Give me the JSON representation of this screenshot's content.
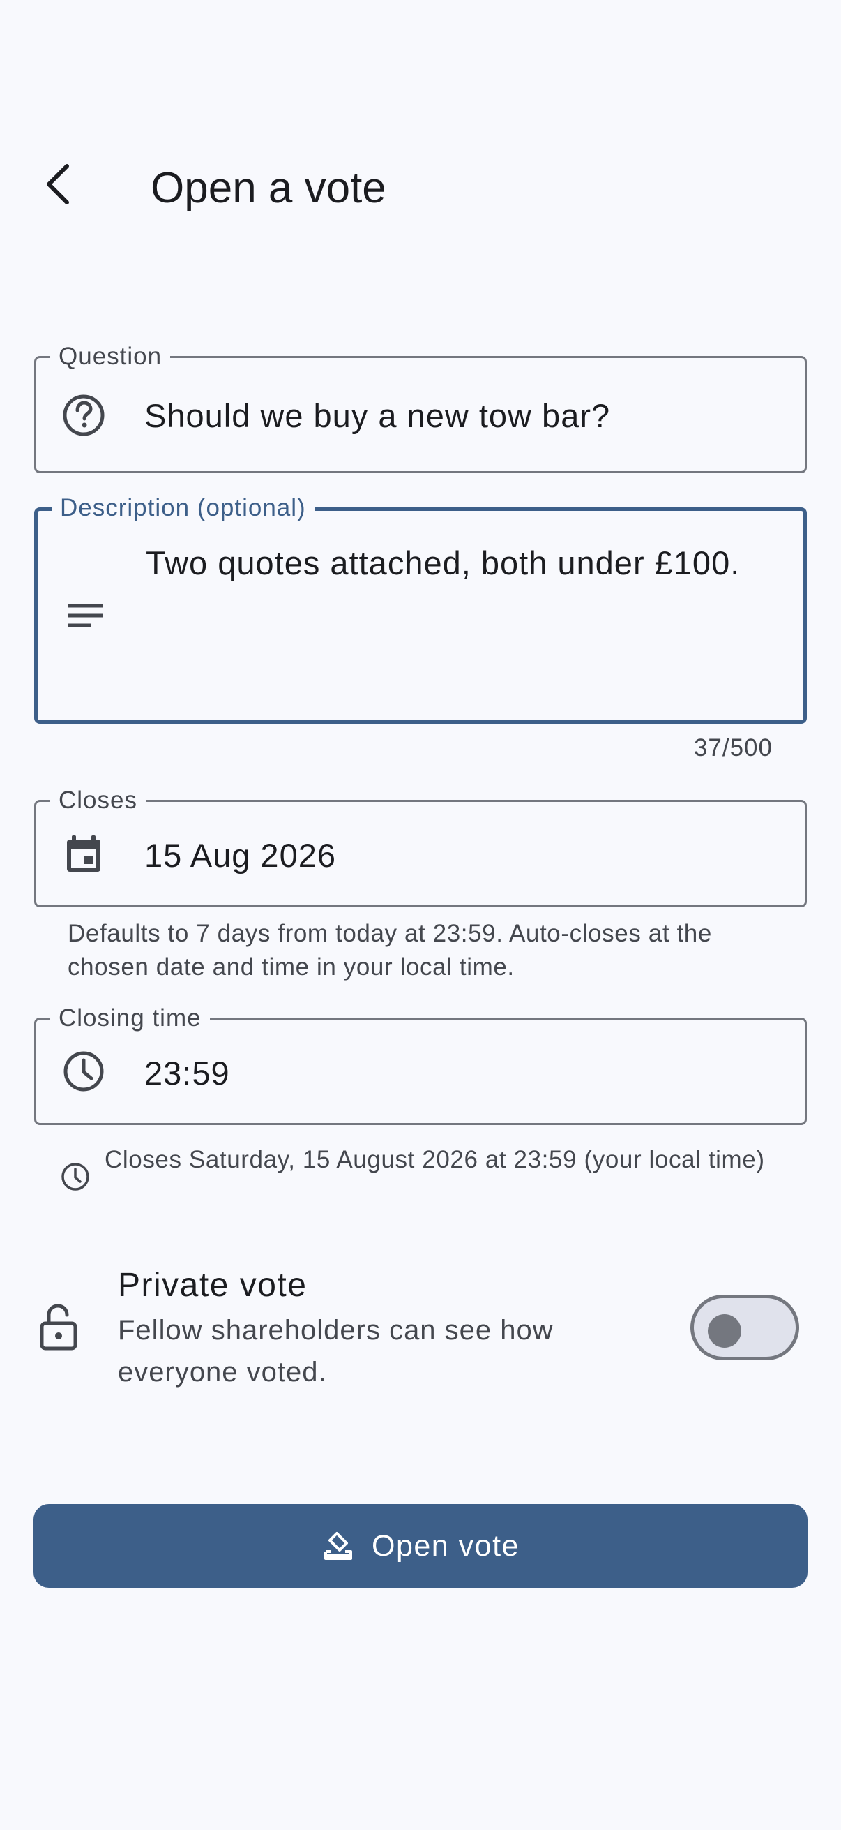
{
  "header": {
    "title": "Open a vote",
    "back_icon": "chevron-left-icon"
  },
  "form": {
    "question": {
      "label": "Question",
      "value": "Should we buy a new tow bar?",
      "icon": "help-circle-icon"
    },
    "description": {
      "label": "Description (optional)",
      "value": "Two quotes attached, both under £100.",
      "icon": "notes-icon",
      "counter": "37/500"
    },
    "closes": {
      "label": "Closes",
      "value": "15 Aug 2026",
      "icon": "calendar-icon",
      "helper": "Defaults to 7 days from today at 23:59. Auto-closes at the chosen date and time in your local time."
    },
    "closing_time": {
      "label": "Closing time",
      "value": "23:59",
      "icon": "clock-icon"
    },
    "summary": {
      "icon": "clock-icon",
      "text": "Closes Saturday, 15 August 2026 at 23:59 (your local time)"
    }
  },
  "private_vote": {
    "icon": "lock-open-icon",
    "title": "Private vote",
    "description": "Fellow shareholders can see how everyone voted.",
    "enabled": false
  },
  "actions": {
    "open_vote_label": "Open vote",
    "open_vote_icon": "ballot-icon"
  },
  "colors": {
    "background": "#f8f9fd",
    "primary": "#3d5f89",
    "outline": "#74777f",
    "on_surface": "#1b1c20",
    "on_surface_variant": "#44474e"
  }
}
